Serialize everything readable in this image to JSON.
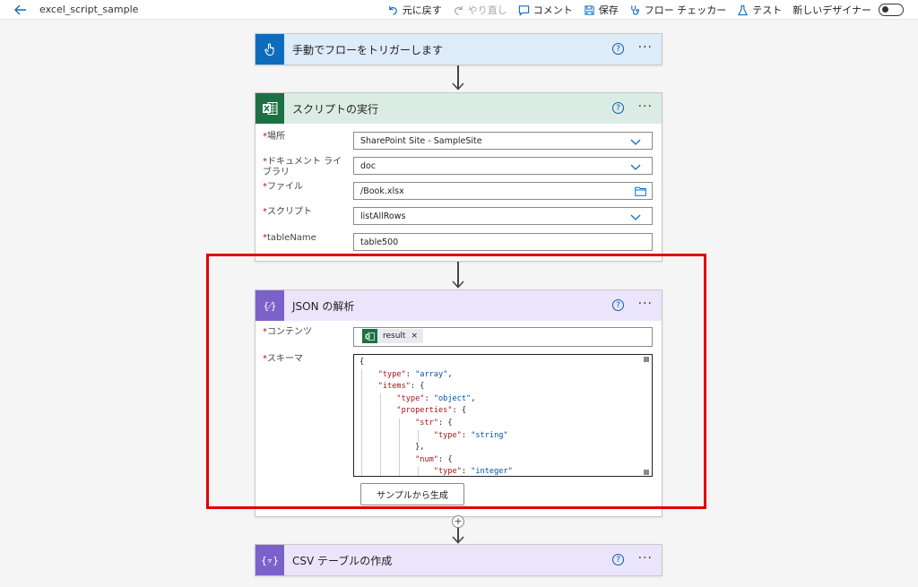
{
  "app": {
    "title": "excel_script_sample"
  },
  "toolbar": {
    "undo": "元に戻す",
    "redo": "やり直し",
    "comment": "コメント",
    "save": "保存",
    "flow_checker": "フロー チェッカー",
    "test": "テスト",
    "new_designer": "新しいデザイナー"
  },
  "colors": {
    "trigger_header": "#deebf8",
    "trigger_icon": "#0f6cbd",
    "excel_header": "#dbece4",
    "excel_icon": "#1d7044",
    "json_header": "#ebe5fc",
    "json_icon": "#7b61c9",
    "highlight": "#e00000"
  },
  "cards": {
    "trigger": {
      "title": "手動でフローをトリガーします",
      "icon": "touch-icon"
    },
    "script": {
      "title": "スクリプトの実行",
      "icon": "excel-icon",
      "fields": [
        {
          "label": "場所",
          "value": "SharePoint Site - SampleSite",
          "type": "dropdown"
        },
        {
          "label": "ドキュメント ライブラリ",
          "value": "doc",
          "type": "dropdown"
        },
        {
          "label": "ファイル",
          "value": "/Book.xlsx",
          "type": "file"
        },
        {
          "label": "スクリプト",
          "value": "listAllRows",
          "type": "dropdown"
        },
        {
          "label": "tableName",
          "value": "table500",
          "type": "text"
        }
      ]
    },
    "json": {
      "title": "JSON の解析",
      "icon": "braces-icon",
      "content_label": "コンテンツ",
      "token": "result",
      "schema_label": "スキーマ",
      "schema_lines": [
        "{",
        "    \"type\": \"array\",",
        "    \"items\": {",
        "        \"type\": \"object\",",
        "        \"properties\": {",
        "            \"str\": {",
        "                \"type\": \"string\"",
        "            },",
        "            \"num\": {",
        "                \"type\": \"integer\""
      ],
      "generate_button": "サンプルから生成"
    },
    "csv": {
      "title": "CSV テーブルの作成",
      "icon": "braces-icon"
    }
  }
}
